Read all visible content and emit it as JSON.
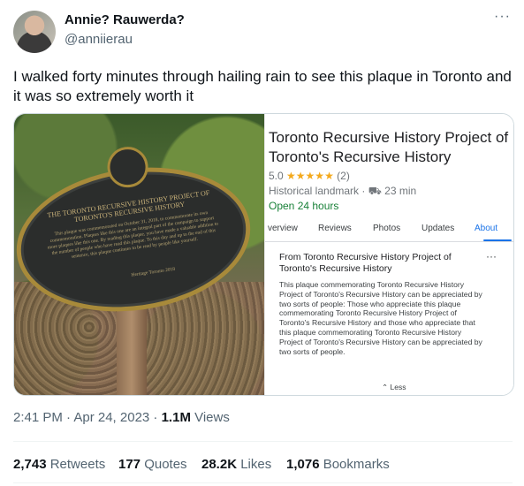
{
  "author": {
    "display_name": "Annie? Rauwerda?",
    "handle": "@anniierau"
  },
  "tweet": {
    "text": "I walked forty minutes through hailing rain to see this plaque in Toronto and it was so extremely worth it"
  },
  "plaque": {
    "title": "THE TORONTO RECURSIVE HISTORY PROJECT OF TORONTO'S RECURSIVE HISTORY",
    "body": "This plaque was commemorated on October 31, 2018, to commemorate its own commemoration. Plaques like this one are an integral part of the campaign to support more plaques like this one. By reading this plaque, you have made a valuable addition to the number of people who have read this plaque. To this day and up to the end of this sentence, this plaque continues to be read by people like yourself.",
    "signature": "Heritage Toronto 2018"
  },
  "place": {
    "title": "Toronto Recursive History Project of Toronto's Recursive History",
    "rating": "5.0",
    "stars": "★★★★★",
    "review_count": "(2)",
    "type": "Historical landmark",
    "drive_icon": "car-icon",
    "drive_time": "23 min",
    "hours": "Open 24 hours",
    "tabs": [
      "verview",
      "Reviews",
      "Photos",
      "Updates",
      "About"
    ],
    "active_tab": "About",
    "card_title": "From Toronto Recursive History Project of Toronto's Recursive History",
    "card_body": "This plaque commemorating Toronto Recursive History Project of Toronto's Recursive History can be appreciated by two sorts of people: Those who appreciate this plaque commemorating Toronto Recursive History Project of Toronto's Recursive History and those who appreciate that this plaque commemorating Toronto Recursive History Project of Toronto's Recursive History can be appreciated by two sorts of people.",
    "less_label": "Less"
  },
  "meta": {
    "timestamp": "2:41 PM · Apr 24, 2023 · ",
    "views_count": "1.1M",
    "views_label": " Views"
  },
  "stats": {
    "retweets_count": "2,743",
    "retweets_label": " Retweets",
    "quotes_count": "177",
    "quotes_label": " Quotes",
    "likes_count": "28.2K",
    "likes_label": " Likes",
    "bookmarks_count": "1,076",
    "bookmarks_label": " Bookmarks"
  },
  "colors": {
    "secondary_text": "#536471",
    "link_blue": "#1a73e8",
    "open_green": "#188038",
    "star_gold": "#f4a91c",
    "plaque_gold": "#a88a3a"
  }
}
